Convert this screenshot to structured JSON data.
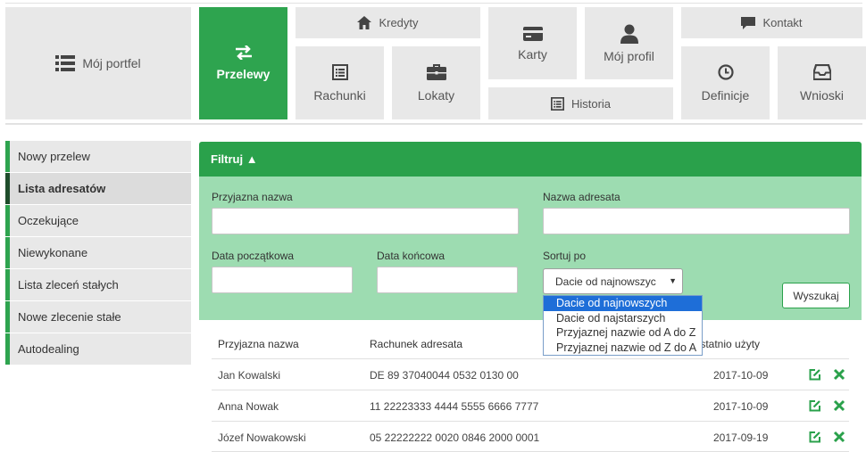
{
  "nav": {
    "portfolio": "Mój portfel",
    "transfers": "Przelewy",
    "credits": "Kredyty",
    "accounts": "Rachunki",
    "deposits": "Lokaty",
    "cards": "Karty",
    "profile": "Mój profil",
    "history": "Historia",
    "contact": "Kontakt",
    "definitions": "Definicje",
    "applications": "Wnioski"
  },
  "sidebar": {
    "items": [
      {
        "label": "Nowy przelew"
      },
      {
        "label": "Lista adresatów"
      },
      {
        "label": "Oczekujące"
      },
      {
        "label": "Niewykonane"
      },
      {
        "label": "Lista zleceń stałych"
      },
      {
        "label": "Nowe zlecenie stałe"
      },
      {
        "label": "Autodealing"
      }
    ]
  },
  "filter": {
    "header": "Filtruj ▲",
    "friendly_name_label": "Przyjazna nazwa",
    "friendly_name_value": "",
    "recipient_name_label": "Nazwa adresata",
    "recipient_name_value": "",
    "date_start_label": "Data początkowa",
    "date_start_value": "",
    "date_end_label": "Data końcowa",
    "date_end_value": "",
    "sort_label": "Sortuj po",
    "sort_selected": "Dacie od najnowszyc",
    "sort_options": [
      "Dacie od najnowszych",
      "Dacie od najstarszych",
      "Przyjaznej nazwie od A do Z",
      "Przyjaznej nazwie od Z do A"
    ],
    "search_button": "Wyszukaj"
  },
  "table": {
    "columns": [
      "Przyjazna nazwa",
      "Rachunek adresata",
      "Ostatnio użyty"
    ],
    "rows": [
      {
        "name": "Jan Kowalski",
        "account": "DE 89 37040044 0532 0130 00",
        "last_used": "2017-10-09"
      },
      {
        "name": "Anna Nowak",
        "account": "11 22223333 4444 5555 6666 7777",
        "last_used": "2017-10-09"
      },
      {
        "name": "Józef Nowakowski",
        "account": "05 22222222 0020 0846 2000 0001",
        "last_used": "2017-09-19"
      }
    ]
  },
  "colors": {
    "accent": "#2aa14b",
    "filter_bg": "#9ddcb1",
    "tile_bg": "#e8e8e8",
    "dropdown_selected": "#1e6ed8"
  },
  "icons": {
    "portfolio": "list-icon",
    "transfers": "exchange-icon",
    "credits": "home-icon",
    "accounts": "document-list-icon",
    "deposits": "briefcase-icon",
    "cards": "credit-card-icon",
    "profile": "user-icon",
    "history": "document-list-icon",
    "contact": "comment-icon",
    "definitions": "clock-icon",
    "applications": "inbox-icon",
    "edit": "edit-icon",
    "delete": "close-icon"
  }
}
